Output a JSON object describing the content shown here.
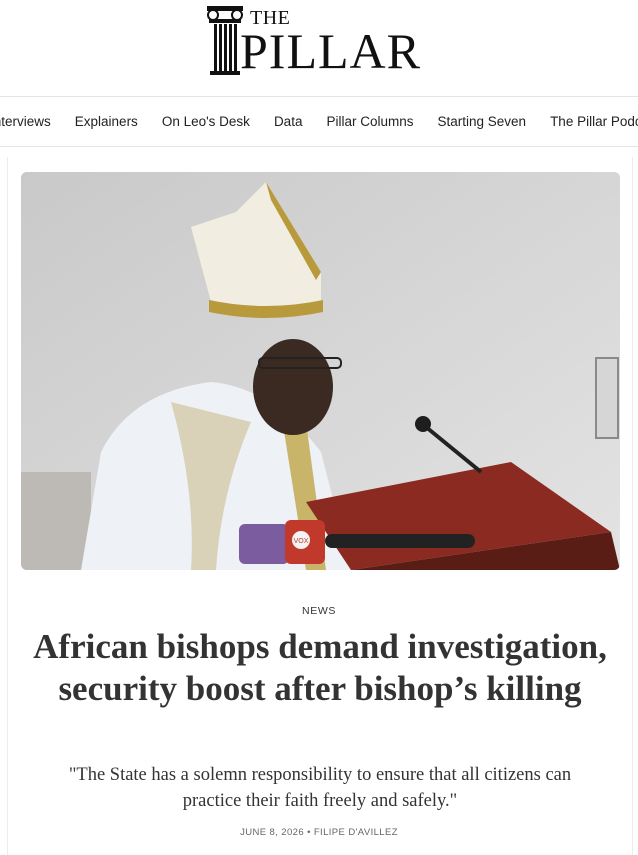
{
  "brand": {
    "logo_the": "THE",
    "logo_pillar": "PILLAR"
  },
  "nav": {
    "items": [
      "Interviews",
      "Explainers",
      "On Leo's Desk",
      "Data",
      "Pillar Columns",
      "Starting Seven",
      "The Pillar Podcast"
    ]
  },
  "article": {
    "category": "NEWS",
    "headline": "African bishops demand investigation, security boost after bishop’s killing",
    "dek": "\"The State has a solemn responsibility to ensure that all citizens can practice their faith freely and safely.\"",
    "date": "JUNE 8, 2026",
    "separator": "•",
    "author": "FILIPE D'AVILLEZ",
    "image": {
      "subject": "bishop-in-mitre-reading-at-lectern",
      "mic_tag": "VOX"
    }
  },
  "colors": {
    "text": "#333333",
    "nav_text": "#222222",
    "byline": "#666666",
    "divider": "#e4e4e4"
  }
}
